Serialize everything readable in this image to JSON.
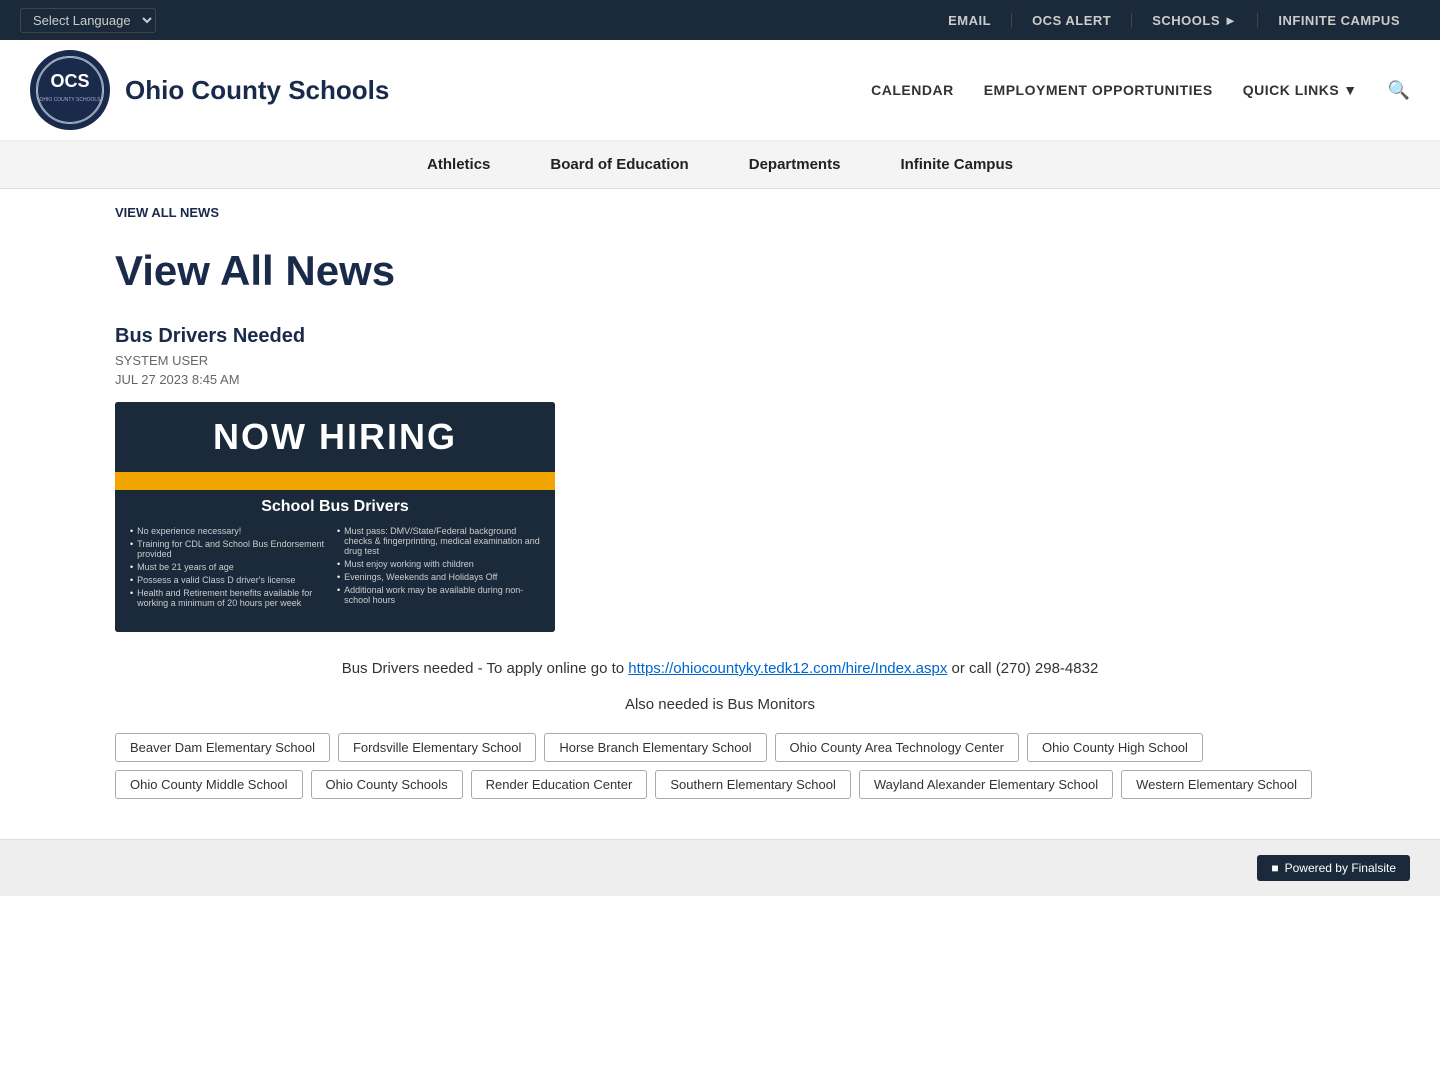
{
  "topbar": {
    "language_select": "Select Language",
    "email_label": "EMAIL",
    "ocs_alert_label": "OCS ALERT",
    "schools_label": "SCHOOLS",
    "infinite_campus_label": "INFINITE CAMPUS"
  },
  "header": {
    "site_name": "Ohio County Schools",
    "logo_alt": "OCS Logo",
    "nav": {
      "calendar": "CALENDAR",
      "employment": "EMPLOYMENT OPPORTUNITIES",
      "quick_links": "QUICK LINKS"
    }
  },
  "sub_nav": {
    "items": [
      "Athletics",
      "Board of Education",
      "Departments",
      "Infinite Campus"
    ]
  },
  "breadcrumb": {
    "label": "VIEW ALL NEWS"
  },
  "page_title": "View All News",
  "article": {
    "title": "Bus Drivers Needed",
    "author": "SYSTEM USER",
    "date": "JUL 27 2023 8:45 AM",
    "hiring_banner": {
      "now_hiring": "NOW HIRING",
      "subtitle": "School Bus Drivers",
      "bullets_left": [
        "No experience necessary!",
        "Training for CDL and School Bus Endorsement provided",
        "Must be 21 years of age",
        "Possess a valid Class D driver's license",
        "Health and Retirement benefits available for working a minimum of 20 hours per week"
      ],
      "bullets_right": [
        "Must pass: DMV/State/Federal background checks & fingerprinting, medical examination and drug test",
        "Must enjoy working with children",
        "Evenings, Weekends and Holidays Off",
        "Additional work may be available during non-school hours"
      ]
    },
    "body_text": "Bus Drivers needed - To apply online go to",
    "apply_link": "https://ohiocountyky.tedk12.com/hire/Index.aspx",
    "apply_link_text": "https://ohiocountyky.tedk12.com/hire/Index.aspx",
    "contact": "or call (270) 298-4832",
    "also_needed": "Also needed is Bus Monitors"
  },
  "tags": [
    "Beaver Dam Elementary School",
    "Fordsville Elementary School",
    "Horse Branch Elementary School",
    "Ohio County Area Technology Center",
    "Ohio County High School",
    "Ohio County Middle School",
    "Ohio County Schools",
    "Render Education Center",
    "Southern Elementary School",
    "Wayland Alexander Elementary School",
    "Western Elementary School"
  ],
  "footer": {
    "powered_by": "Powered by Finalsite"
  }
}
